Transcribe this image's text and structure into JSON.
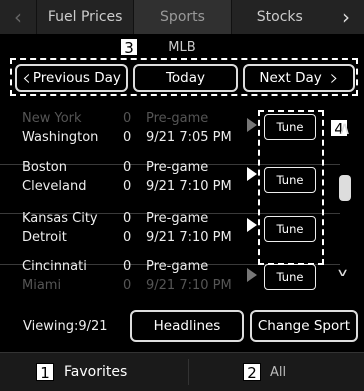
{
  "tabs": {
    "items": [
      {
        "label": "Fuel Prices"
      },
      {
        "label": "Sports"
      },
      {
        "label": "Stocks"
      }
    ]
  },
  "callouts": [
    "1",
    "2",
    "3",
    "4"
  ],
  "league": "MLB",
  "daynav": {
    "prev": "Previous Day",
    "today": "Today",
    "next": "Next Day"
  },
  "games": [
    {
      "team1": "New York",
      "team2": "Washington",
      "score1": "0",
      "score2": "0",
      "status": "Pre-game",
      "time": "9/21 7:05 PM",
      "tune": "Tune"
    },
    {
      "team1": "Boston",
      "team2": "Cleveland",
      "score1": "0",
      "score2": "0",
      "status": "Pre-game",
      "time": "9/21 7:10 PM",
      "tune": "Tune"
    },
    {
      "team1": "Kansas City",
      "team2": "Detroit",
      "score1": "0",
      "score2": "0",
      "status": "Pre-game",
      "time": "9/21 7:10 PM",
      "tune": "Tune"
    },
    {
      "team1": "Cincinnati",
      "team2": "Miami",
      "score1": "0",
      "score2": "0",
      "status": "Pre-game",
      "time": "9/21 7:10 PM",
      "tune": "Tune"
    }
  ],
  "footer": {
    "viewing": "Viewing:9/21",
    "headlines": "Headlines",
    "change_sport": "Change Sport"
  },
  "bottom_tabs": {
    "favorites": "Favorites",
    "all": "All"
  },
  "icons": {
    "left_arrow": "chevron-left-icon",
    "right_arrow": "chevron-right-icon",
    "play": "play-icon",
    "scroll_up": "chevron-up-icon",
    "scroll_down": "chevron-down-icon"
  }
}
